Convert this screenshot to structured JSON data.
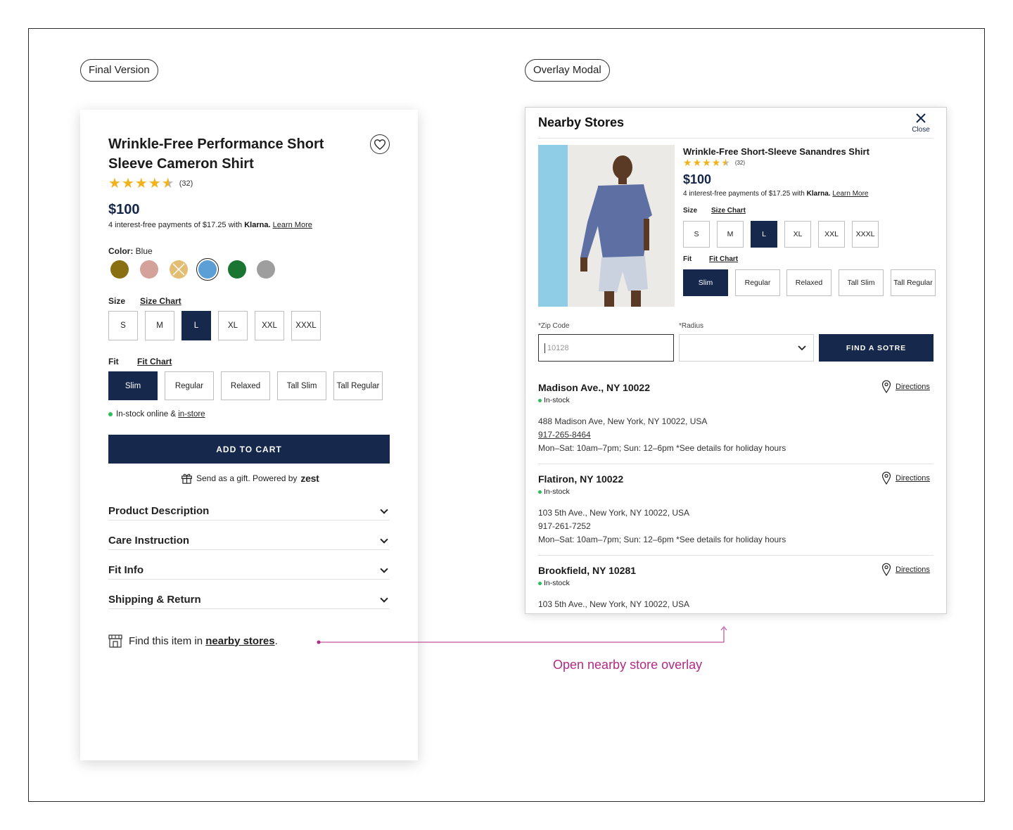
{
  "labels": {
    "final_version": "Final Version",
    "overlay_modal": "Overlay Modal"
  },
  "product": {
    "title_line1": "Wrinkle-Free Performance Short",
    "title_line2": "Sleeve Cameron Shirt",
    "rating": 4.5,
    "review_count": "(32)",
    "price": "$100",
    "klarna_prefix": "4 interest-free payments of $17.25 with",
    "klarna_brand": "Klarna.",
    "learn_more": "Learn More",
    "color_label": "Color:",
    "color_value": "Blue",
    "colors": [
      {
        "name": "olive",
        "hex": "#8a6f12"
      },
      {
        "name": "rose",
        "hex": "#d4a19b"
      },
      {
        "name": "tan",
        "hex": "#e3bd73"
      },
      {
        "name": "blue",
        "hex": "#5c9fd6"
      },
      {
        "name": "green",
        "hex": "#1a7432"
      },
      {
        "name": "grey",
        "hex": "#9e9e9e"
      }
    ],
    "size_label": "Size",
    "size_chart": "Size Chart",
    "sizes": [
      "S",
      "M",
      "L",
      "XL",
      "XXL",
      "XXXL"
    ],
    "selected_size": "L",
    "fit_label": "Fit",
    "fit_chart": "Fit Chart",
    "fits": [
      "Slim",
      "Regular",
      "Relaxed",
      "Tall Slim",
      "Tall Regular"
    ],
    "selected_fit": "Slim",
    "stock_text": "In-stock online &",
    "stock_link": "in-store",
    "add_to_cart": "ADD TO CART",
    "gift_text": "Send as a gift. Powered by",
    "gift_brand": "zest",
    "accordions": [
      "Product Description",
      "Care Instruction",
      "Fit Info",
      "Shipping & Return"
    ],
    "nearby_prefix": "Find this item in",
    "nearby_link": "nearby stores",
    "nearby_suffix": "."
  },
  "modal": {
    "title": "Nearby Stores",
    "close": "Close",
    "product_title": "Wrinkle-Free Short-Sleeve Sanandres Shirt",
    "review_count": "(32)",
    "price": "$100",
    "klarna_prefix": "4 interest-free payments of $17.25 with",
    "klarna_brand": "Klarna.",
    "learn_more": "Learn More",
    "size_label": "Size",
    "size_chart": "Size Chart",
    "fit_label": "Fit",
    "fit_chart": "Fit Chart",
    "zip_label": "*Zip Code",
    "zip_placeholder": "10128",
    "radius_label": "*Radius",
    "find_button": "FIND A SOTRE",
    "directions": "Directions",
    "stores": [
      {
        "name": "Madison Ave., NY 10022",
        "stock": "In-stock",
        "address": "488 Madison Ave, New York, NY 10022, USA",
        "phone": "917-265-8464",
        "hours": "Mon–Sat: 10am–7pm; Sun: 12–6pm *See details for holiday hours"
      },
      {
        "name": "Flatiron, NY 10022",
        "stock": "In-stock",
        "address": "103 5th Ave., New York, NY 10022, USA",
        "phone": "917-261-7252",
        "hours": "Mon–Sat: 10am–7pm; Sun: 12–6pm *See details for holiday hours"
      },
      {
        "name": "Brookfield, NY 10281",
        "stock": "In-stock",
        "address": "103 5th Ave., New York, NY 10022, USA"
      }
    ]
  },
  "annotation": {
    "text": "Open nearby store overlay",
    "color": "#b42a83"
  },
  "theme": {
    "navy": "#16284c",
    "star": "#f2b21a",
    "stock_green": "#2bbf5a"
  }
}
